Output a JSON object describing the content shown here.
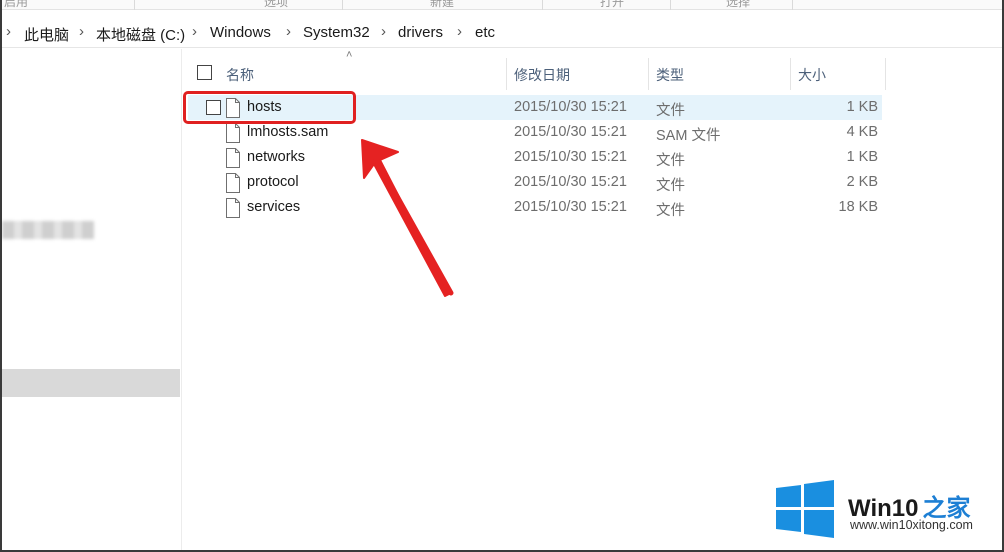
{
  "ribbon": {
    "tabs": [
      "启用",
      "选项",
      "新建",
      "打开",
      "选择"
    ]
  },
  "breadcrumb": {
    "items": [
      "此电脑",
      "本地磁盘 (C:)",
      "Windows",
      "System32",
      "drivers",
      "etc"
    ],
    "separator": "›"
  },
  "columns": {
    "name": "名称",
    "date": "修改日期",
    "type": "类型",
    "size": "大小"
  },
  "files": [
    {
      "name": "hosts",
      "date": "2015/10/30 15:21",
      "type": "文件",
      "size": "1 KB",
      "highlighted": true
    },
    {
      "name": "lmhosts.sam",
      "date": "2015/10/30 15:21",
      "type": "SAM 文件",
      "size": "4 KB",
      "highlighted": false
    },
    {
      "name": "networks",
      "date": "2015/10/30 15:21",
      "type": "文件",
      "size": "1 KB",
      "highlighted": false
    },
    {
      "name": "protocol",
      "date": "2015/10/30 15:21",
      "type": "文件",
      "size": "2 KB",
      "highlighted": false
    },
    {
      "name": "services",
      "date": "2015/10/30 15:21",
      "type": "文件",
      "size": "18 KB",
      "highlighted": false
    }
  ],
  "icons": {
    "file": "file-icon",
    "checkbox": "checkbox",
    "sort": "sort-up-arrow-icon",
    "chevron": "chevron-right-icon"
  },
  "colors": {
    "hover_row": "#e5f3fb",
    "annotation": "#e02020",
    "header_text": "#4c607a",
    "brand_blue": "#1d7fd4"
  },
  "watermark": {
    "brand": "Win10",
    "brand_zh": "之家",
    "url": "www.win10xitong.com"
  }
}
